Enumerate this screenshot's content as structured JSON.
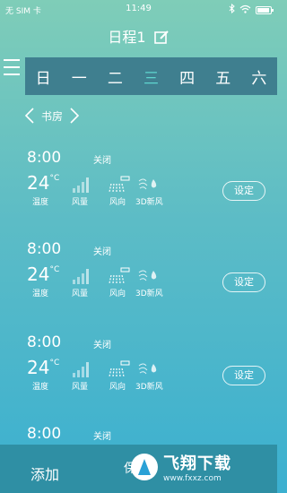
{
  "status": {
    "carrier": "无 SIM 卡",
    "time": "11:49"
  },
  "header": {
    "title": "日程1"
  },
  "weekdays": [
    "日",
    "一",
    "二",
    "三",
    "四",
    "五",
    "六"
  ],
  "active_weekday": "三",
  "room": {
    "name": "书房"
  },
  "entries": [
    {
      "time": "8:00",
      "state": "关闭",
      "temp": "24",
      "unit": "°C",
      "labels": {
        "temp": "温度",
        "fan": "风量",
        "direction": "风向",
        "air": "3D新风"
      },
      "set_label": "设定"
    },
    {
      "time": "8:00",
      "state": "关闭",
      "temp": "24",
      "unit": "°C",
      "labels": {
        "temp": "温度",
        "fan": "风量",
        "direction": "风向",
        "air": "3D新风"
      },
      "set_label": "设定"
    },
    {
      "time": "8:00",
      "state": "关闭",
      "temp": "24",
      "unit": "°C",
      "labels": {
        "temp": "温度",
        "fan": "风量",
        "direction": "风向",
        "air": "3D新风"
      },
      "set_label": "设定"
    },
    {
      "time": "8:00",
      "state": "关闭"
    }
  ],
  "bottom": {
    "add_label": "添加",
    "mid_label": "保"
  },
  "watermark": {
    "text": "飞翔下载",
    "url": "www.fxxz.com"
  },
  "colors": {
    "accent": "#5fd6cf",
    "week_bar": "#3f7f8f",
    "bottom_bar": "#2f8fa4"
  }
}
